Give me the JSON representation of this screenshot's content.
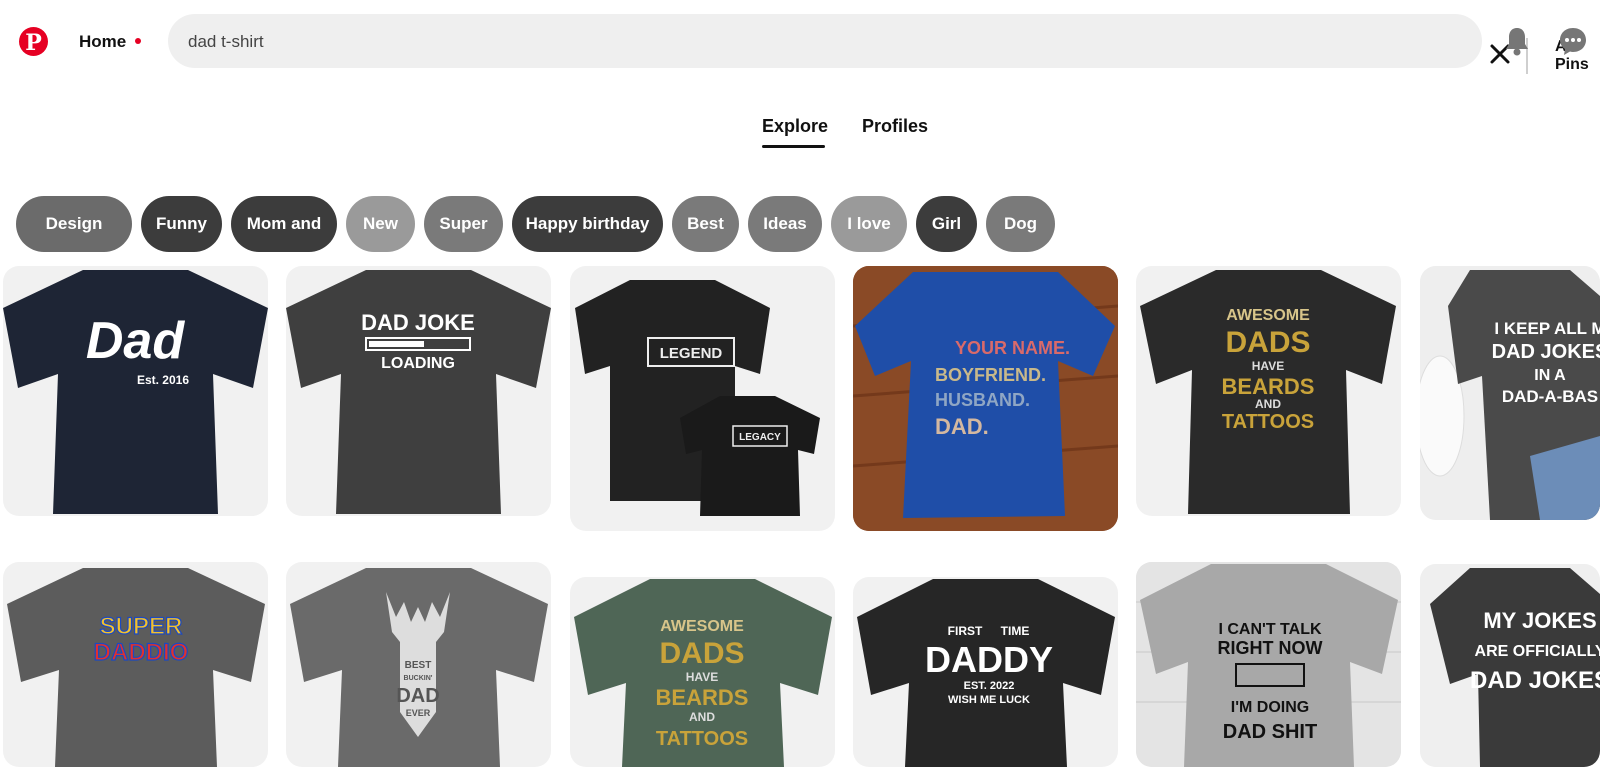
{
  "header": {
    "home_label": "Home",
    "search_value": "dad t-shirt",
    "filter_label": "All Pins",
    "brand_color": "#e60023"
  },
  "tabs": [
    {
      "label": "Explore",
      "active": true
    },
    {
      "label": "Profiles",
      "active": false
    }
  ],
  "chips": [
    {
      "label": "Design",
      "color": "#6b6b6b"
    },
    {
      "label": "Funny",
      "color": "#3c3c3c"
    },
    {
      "label": "Mom and",
      "color": "#3c3c3c"
    },
    {
      "label": "New",
      "color": "#9a9a9a"
    },
    {
      "label": "Super",
      "color": "#7a7a7a"
    },
    {
      "label": "Happy birthday",
      "color": "#3c3c3c"
    },
    {
      "label": "Best",
      "color": "#7a7a7a"
    },
    {
      "label": "Ideas",
      "color": "#7a7a7a"
    },
    {
      "label": "I love",
      "color": "#9a9a9a"
    },
    {
      "label": "Girl",
      "color": "#3c3c3c"
    },
    {
      "label": "Dog",
      "color": "#7a7a7a"
    }
  ],
  "pins": [
    {
      "shirt_color": "#1e2535",
      "lines": [
        "Dad",
        "Est. 2016"
      ]
    },
    {
      "shirt_color": "#3f3f3f",
      "lines": [
        "DAD JOKE",
        "LOADING"
      ]
    },
    {
      "shirt_color": "#222222",
      "lines": [
        "LEGEND",
        "LEGACY"
      ]
    },
    {
      "shirt_color": "#1f4ea8",
      "lines": [
        "YOUR NAME.",
        "BOYFRIEND.",
        "HUSBAND.",
        "DAD."
      ]
    },
    {
      "shirt_color": "#2a2a2a",
      "lines": [
        "AWESOME",
        "DADS",
        "HAVE",
        "BEARDS",
        "AND",
        "TATTOOS"
      ]
    },
    {
      "shirt_color": "#4a4a4a",
      "lines": [
        "I KEEP ALL M",
        "DAD JOKES",
        "IN A",
        "DAD-A-BAS"
      ]
    },
    {
      "shirt_color": "#5c5c5c",
      "lines": [
        "SUPER",
        "DADDIO"
      ]
    },
    {
      "shirt_color": "#6a6a6a",
      "lines": [
        "BEST",
        "BUCKIN'",
        "DAD",
        "EVER"
      ]
    },
    {
      "shirt_color": "#4f6656",
      "lines": [
        "AWESOME",
        "DADS",
        "HAVE",
        "BEARDS",
        "AND",
        "TATTOOS"
      ]
    },
    {
      "shirt_color": "#262626",
      "lines": [
        "FIRST",
        "TIME",
        "DADDY",
        "EST. 2022",
        "WISH ME LUCK"
      ]
    },
    {
      "shirt_color": "#a8a8a8",
      "lines": [
        "I CAN'T TALK",
        "RIGHT NOW",
        "I'M DOING",
        "DAD SHIT"
      ]
    },
    {
      "shirt_color": "#3a3a3a",
      "lines": [
        "MY JOKES",
        "ARE OFFICIALLY",
        "DAD JOKES"
      ]
    }
  ]
}
